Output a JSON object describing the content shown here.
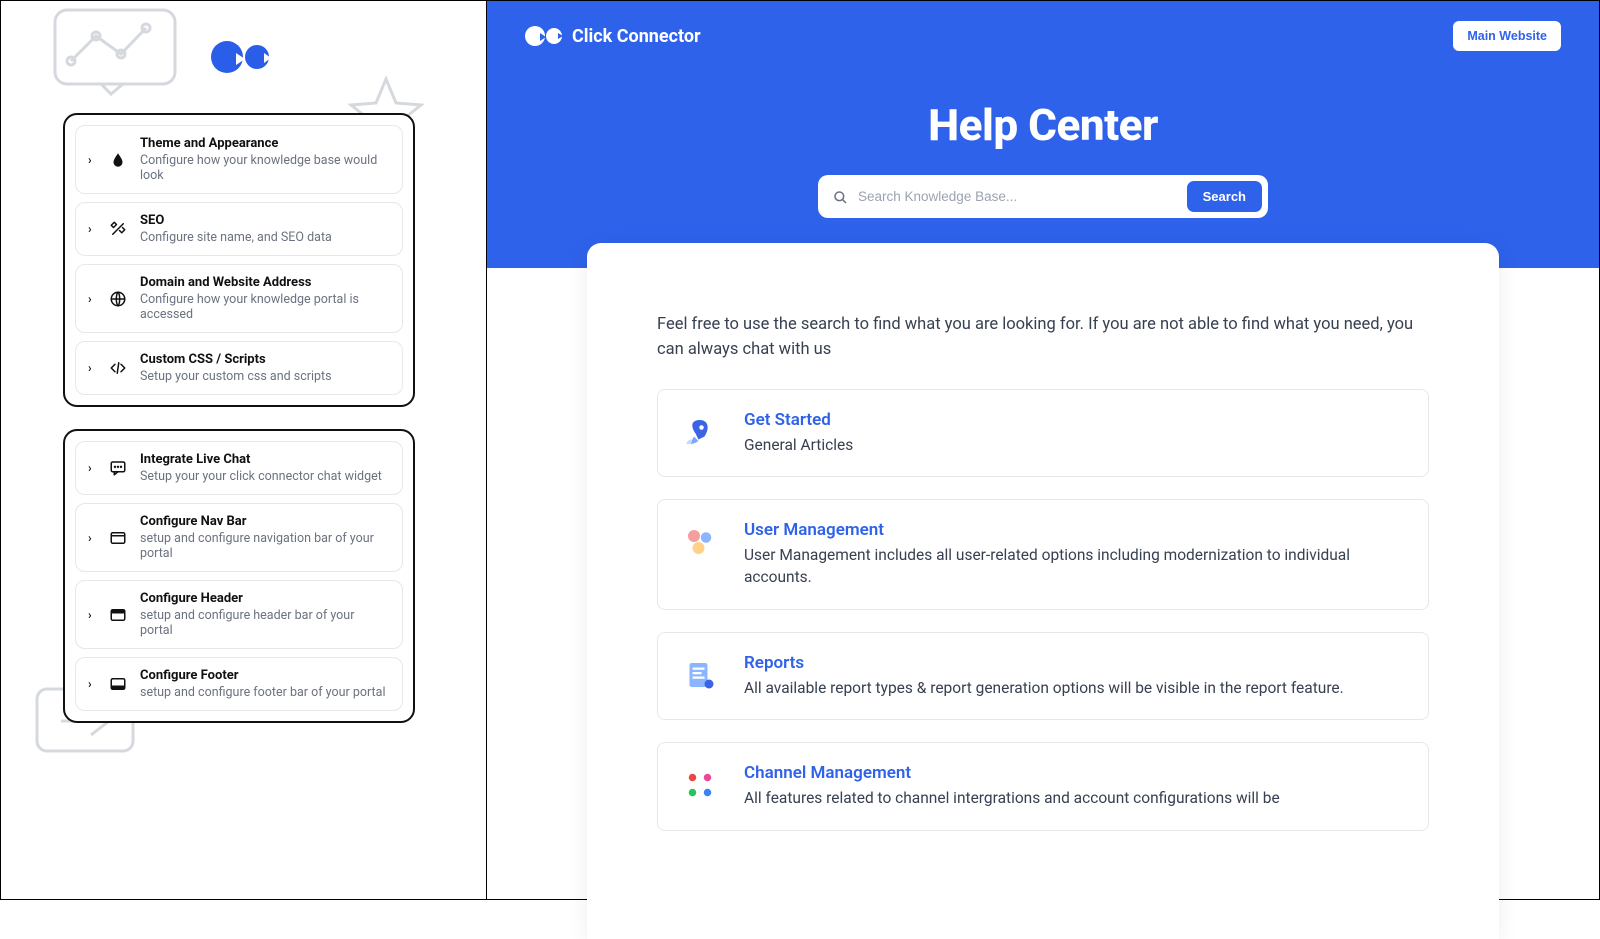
{
  "brand": {
    "name": "Click Connector"
  },
  "leftPanel": {
    "group1": [
      {
        "title": "Theme and Appearance",
        "desc": "Configure how your knowledge base would look",
        "icon": "droplet"
      },
      {
        "title": "SEO",
        "desc": "Configure site name, and SEO data",
        "icon": "tools"
      },
      {
        "title": "Domain and Website Address",
        "desc": "Configure how your knowledge portal is accessed",
        "icon": "globe"
      },
      {
        "title": "Custom CSS / Scripts",
        "desc": "Setup your custom css and scripts",
        "icon": "code"
      }
    ],
    "group2": [
      {
        "title": "Integrate Live Chat",
        "desc": "Setup your your click connector chat widget",
        "icon": "chat"
      },
      {
        "title": "Configure Nav Bar",
        "desc": "setup and configure navigation bar of your portal",
        "icon": "layout-top"
      },
      {
        "title": "Configure Header",
        "desc": "setup and configure header bar of your portal",
        "icon": "layout-header"
      },
      {
        "title": "Configure Footer",
        "desc": "setup and configure footer bar of your portal",
        "icon": "layout-footer"
      }
    ]
  },
  "helpCenter": {
    "mainWebsiteLabel": "Main Website",
    "title": "Help Center",
    "searchPlaceholder": "Search Knowledge Base...",
    "searchButton": "Search",
    "intro": "Feel free to use the search to find what you are looking for. If you are not able to find what you need, you can always chat with us",
    "topics": [
      {
        "title": "Get Started",
        "desc": "General Articles",
        "icon": "rocket"
      },
      {
        "title": "User Management",
        "desc": "User Management includes all user-related options including modernization to individual accounts.",
        "icon": "users"
      },
      {
        "title": "Reports",
        "desc": "All available report types & report generation options will be visible in the report feature.",
        "icon": "report"
      },
      {
        "title": "Channel Management",
        "desc": "All features related to channel intergrations and account configurations will be",
        "icon": "channels"
      }
    ]
  }
}
